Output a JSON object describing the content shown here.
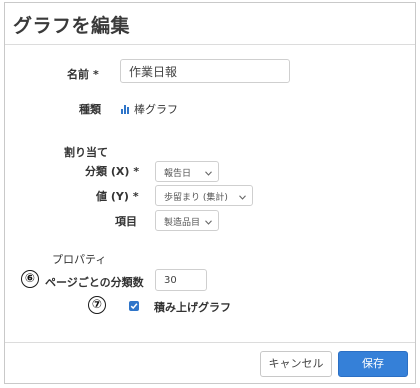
{
  "dialog": {
    "title": "グラフを編集"
  },
  "form": {
    "name": {
      "label": "名前",
      "required_mark": "*",
      "value": "作業日報"
    },
    "type": {
      "label": "種類",
      "value": "棒グラフ",
      "icon": "bar-chart-icon"
    },
    "assignment": {
      "heading": "割り当て",
      "category": {
        "label": "分類 (X)",
        "required_mark": "*",
        "value": "報告日"
      },
      "value": {
        "label": "値 (Y)",
        "required_mark": "*",
        "value": "歩留まり (集計)"
      },
      "item": {
        "label": "項目",
        "value": "製造品目"
      }
    },
    "properties": {
      "heading": "プロパティ",
      "per_page": {
        "label": "ページごとの分類数",
        "value": "30",
        "callout": "⑥"
      },
      "stacked": {
        "label": "積み上げグラフ",
        "checked": true,
        "callout": "⑦"
      }
    }
  },
  "footer": {
    "cancel_label": "キャンセル",
    "save_label": "保存"
  },
  "colors": {
    "accent": "#3580d8",
    "icon_blue": "#2f75c9"
  }
}
